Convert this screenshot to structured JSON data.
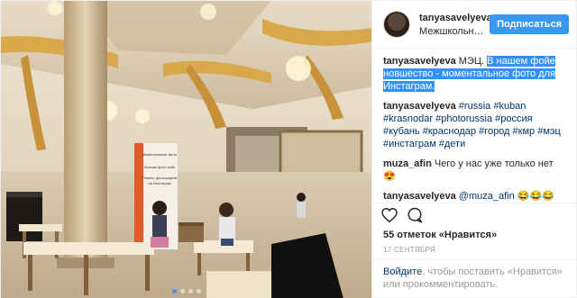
{
  "post": {
    "username": "tanyasavelyeva",
    "location": "Межшкольный ...",
    "follow_label": "Подписаться",
    "caption_prefix": "МЭЦ. ",
    "caption_highlight": "В нашем фойе новшество - моментальное фото для Инстаграм."
  },
  "comments": [
    {
      "user": "tanyasavelyeva",
      "tags": [
        "#russia",
        "#kuban",
        "#krasnodar",
        "#photorussia",
        "#россия",
        "#кубань",
        "#краснодар",
        "#город",
        "#кмр",
        "#мэц",
        "#инстаграм",
        "#дети"
      ]
    },
    {
      "user": "muza_afin",
      "text": "Чего у нас уже только нет😍"
    },
    {
      "user": "tanyasavelyeva",
      "mention": "@muza_afin",
      "text": " 😂😂😂"
    }
  ],
  "stats": {
    "likes_count": "55 отметок",
    "likes_suffix": "«Нравится»",
    "date": "17 СЕНТЯБРЯ"
  },
  "login_prompt": {
    "link1": "Войдите",
    "text1": ", чтобы поставить «Нравится»",
    "text2": "или прокомментировать.",
    "link2_placeholder": ""
  },
  "photo": {
    "poster_lines": [
      "Моментальное фото",
      "Хочешь фото себе",
      "Повесь фотографий",
      "на Инстаграм"
    ],
    "carousel_count": 4,
    "carousel_active": 1
  },
  "icons": {
    "heart": "heart-icon",
    "comment": "comment-icon"
  }
}
